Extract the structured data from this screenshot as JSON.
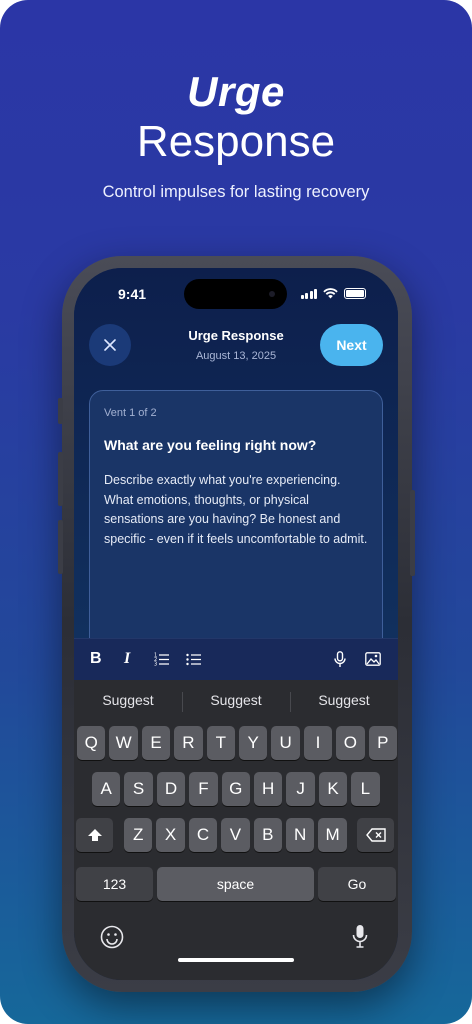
{
  "marketing": {
    "headline_1": "Urge",
    "headline_2": "Response",
    "subtitle": "Control impulses for lasting recovery"
  },
  "status_bar": {
    "time": "9:41"
  },
  "header": {
    "title": "Urge Response",
    "date": "August 13, 2025",
    "next_label": "Next",
    "close_icon": "close-icon"
  },
  "card": {
    "step": "Vent 1 of 2",
    "question": "What are you feeling right now?",
    "placeholder": "Describe exactly what you're experiencing. What emotions, thoughts, or physical sensations are you having? Be honest and specific - even if it feels uncomfortable to admit."
  },
  "toolbar": {
    "bold": "B",
    "italic": "I",
    "icons": [
      "bold-icon",
      "italic-icon",
      "numbered-list-icon",
      "bullet-list-icon",
      "microphone-icon",
      "image-icon"
    ]
  },
  "keyboard": {
    "suggestions": [
      "Suggest",
      "Suggest",
      "Suggest"
    ],
    "row1": [
      "Q",
      "W",
      "E",
      "R",
      "T",
      "Y",
      "U",
      "I",
      "O",
      "P"
    ],
    "row2": [
      "A",
      "S",
      "D",
      "F",
      "G",
      "H",
      "J",
      "K",
      "L"
    ],
    "row3": [
      "Z",
      "X",
      "C",
      "V",
      "B",
      "N",
      "M"
    ],
    "numbers_label": "123",
    "space_label": "space",
    "go_label": "Go"
  },
  "colors": {
    "accent": "#4ab4ee",
    "background_top": "#2b36a6",
    "background_bottom": "#16689a"
  }
}
